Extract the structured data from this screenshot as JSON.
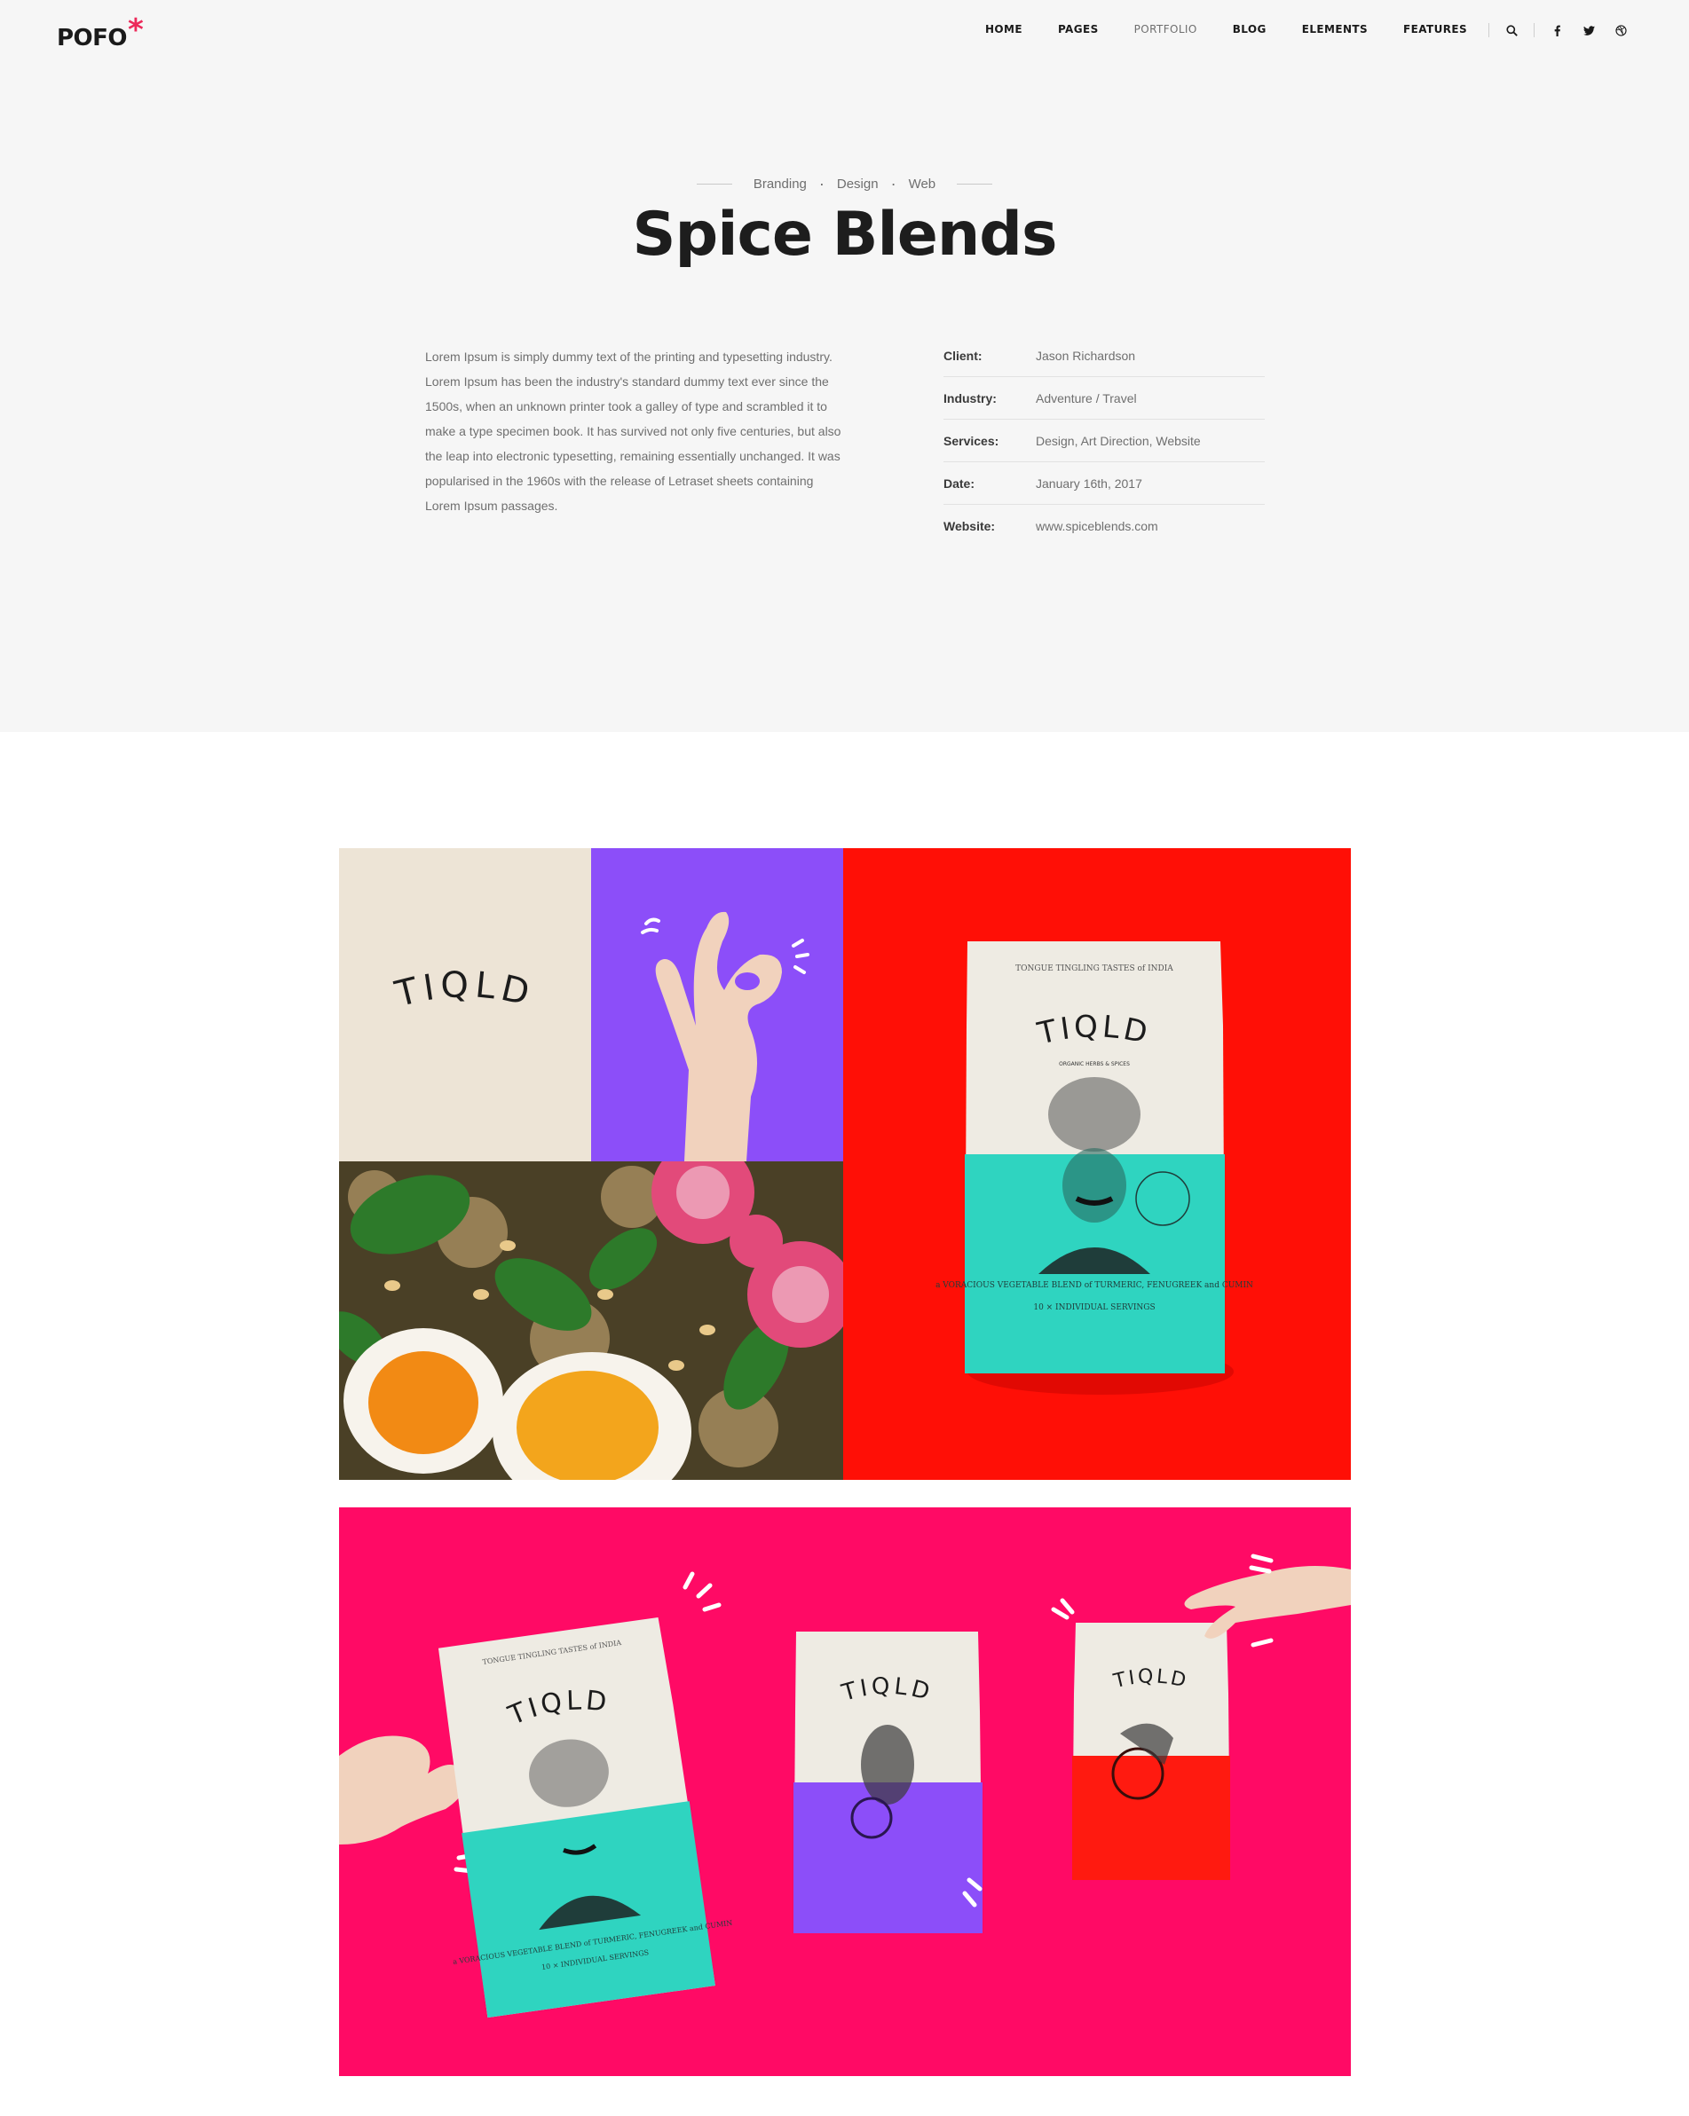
{
  "brand": {
    "name": "POFO",
    "mark": "*"
  },
  "nav": {
    "items": [
      {
        "label": "HOME"
      },
      {
        "label": "PAGES"
      },
      {
        "label": "PORTFOLIO"
      },
      {
        "label": "BLOG"
      },
      {
        "label": "ELEMENTS"
      },
      {
        "label": "FEATURES"
      }
    ],
    "icons": [
      "search-icon",
      "facebook-icon",
      "twitter-icon",
      "dribbble-icon"
    ]
  },
  "project": {
    "categories": [
      "Branding",
      "Design",
      "Web"
    ],
    "title": "Spice Blends",
    "description": "Lorem Ipsum is simply dummy text of the printing and typesetting industry. Lorem Ipsum has been the industry's standard dummy text ever since the 1500s, when an unknown printer took a galley of type and scrambled it to make a type specimen book. It has survived not only five centuries, but also the leap into electronic typesetting, remaining essentially unchanged. It was popularised in the 1960s with the release of Letraset sheets containing Lorem Ipsum passages.",
    "details": [
      {
        "label": "Client:",
        "value": "Jason Richardson"
      },
      {
        "label": "Industry:",
        "value": "Adventure / Travel"
      },
      {
        "label": "Services:",
        "value": "Design, Art Direction, Website"
      },
      {
        "label": "Date:",
        "value": "January 16th, 2017"
      },
      {
        "label": "Website:",
        "value": "www.spiceblends.com"
      }
    ]
  },
  "gallery": {
    "brand_text": "TIQLD",
    "pack_top": "TONGUE TINGLING TASTES of INDIA",
    "pack_sub": "ORGANIC HERBS & SPICES",
    "pack_blend": "a VORACIOUS VEGETABLE BLEND of TURMERIC, FENUGREEK and CUMIN",
    "pack_servings": "10 × INDIVIDUAL SERVINGS",
    "colors": {
      "cream": "#ede4d6",
      "violet": "#8c4ef9",
      "red": "#ff0f06",
      "pink": "#ff0a65",
      "teal": "#2fd4c0"
    }
  }
}
